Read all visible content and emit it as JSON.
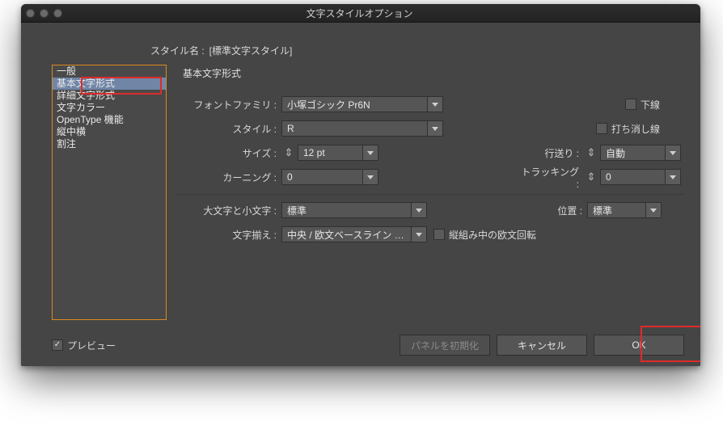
{
  "window": {
    "title": "文字スタイルオプション"
  },
  "style_name": {
    "label": "スタイル名 :",
    "value": "[標準文字スタイル]"
  },
  "sidebar": {
    "items": [
      {
        "label": "一般"
      },
      {
        "label": "基本文字形式"
      },
      {
        "label": "詳細文字形式"
      },
      {
        "label": "文字カラー"
      },
      {
        "label": "OpenType 機能"
      },
      {
        "label": "縦中横"
      },
      {
        "label": "割注"
      }
    ],
    "selected_index": 1
  },
  "section": {
    "title": "基本文字形式"
  },
  "form": {
    "font_family": {
      "label": "フォントファミリ :",
      "value": "小塚ゴシック Pr6N"
    },
    "style": {
      "label": "スタイル :",
      "value": "R"
    },
    "size": {
      "label": "サイズ :",
      "value": "12 pt"
    },
    "kerning": {
      "label": "カーニング :",
      "value": "0"
    },
    "leading": {
      "label": "行送り :",
      "value": "自動"
    },
    "tracking": {
      "label": "トラッキング :",
      "value": "0"
    },
    "underline": {
      "label": "下線",
      "checked": false
    },
    "strike": {
      "label": "打ち消し線",
      "checked": false
    },
    "case": {
      "label": "大文字と小文字 :",
      "value": "標準"
    },
    "position": {
      "label": "位置 :",
      "value": "標準"
    },
    "align": {
      "label": "文字揃え :",
      "value": "中央 / 欧文ベースライン (…"
    },
    "vert_rotate": {
      "label": "縦組み中の欧文回転",
      "checked": false
    }
  },
  "footer": {
    "preview": {
      "label": "プレビュー",
      "checked": true
    },
    "reset": {
      "label": "パネルを初期化"
    },
    "cancel": {
      "label": "キャンセル"
    },
    "ok": {
      "label": "OK"
    }
  }
}
